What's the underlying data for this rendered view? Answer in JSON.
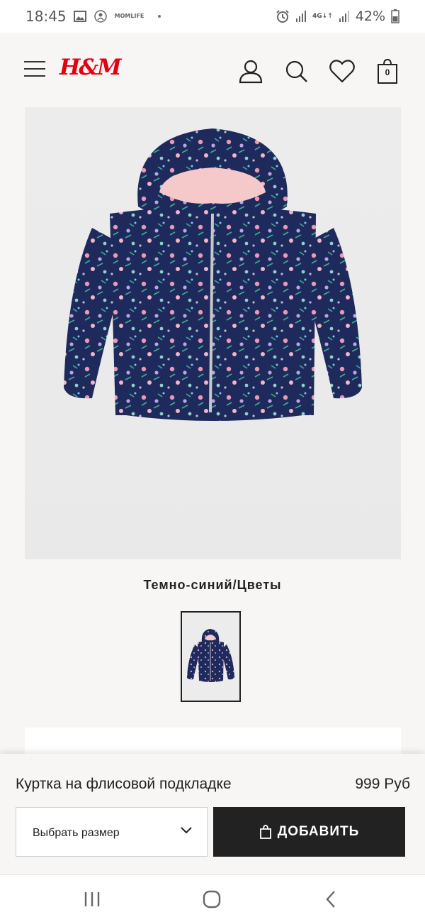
{
  "status_bar": {
    "time": "18:45",
    "notification_icons": [
      "image-icon",
      "mom-life-app-icon"
    ],
    "mom_life_text_line1": "MOM",
    "mom_life_text_line2": "LIFE",
    "network_label_top": "4G",
    "network_label_bottom": "↓↑",
    "battery": "42%"
  },
  "header": {
    "logo": "H&M",
    "cart_count": "0",
    "brand_color": "#e50010"
  },
  "product": {
    "color_name": "Темно-синий/Цветы",
    "title": "Куртка на флисовой подкладке",
    "price": "999 Руб",
    "size_select_placeholder": "Выбрать размер",
    "add_button_label": "ДОБАВИТЬ"
  },
  "theme": {
    "background": "#f7f6f4",
    "button_dark": "#222222",
    "jacket_navy": "#1f2a5c",
    "lining_pink": "#f5c9c9"
  }
}
